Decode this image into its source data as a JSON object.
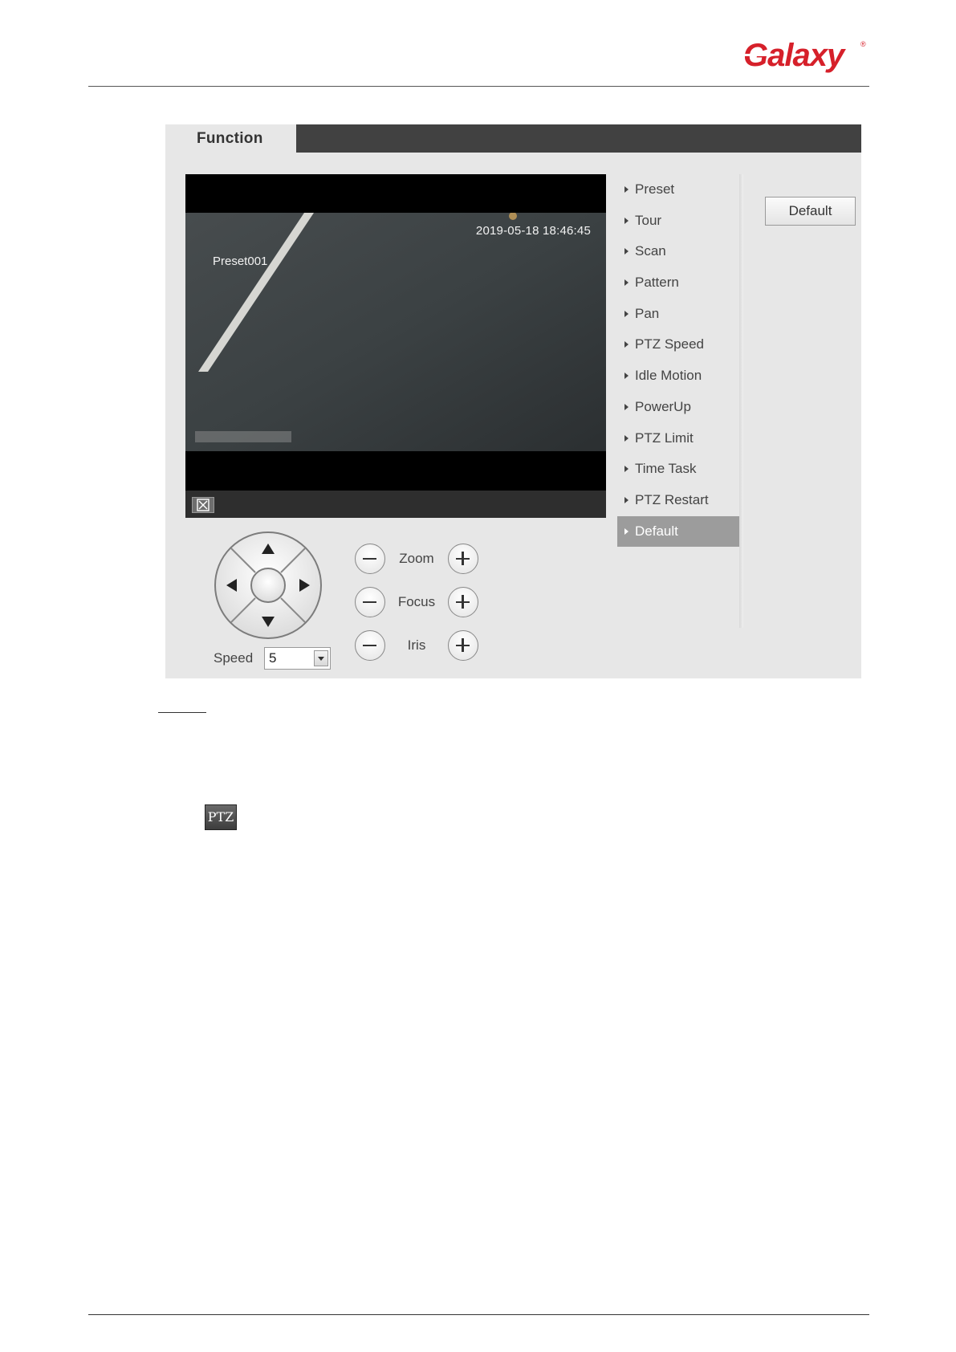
{
  "brand": {
    "logo_text": "Galaxy",
    "registered": "®"
  },
  "panel": {
    "tab_label": "Function",
    "video": {
      "timestamp": "2019-05-18 18:46:45",
      "preset_label": "Preset001"
    },
    "menu": [
      {
        "label": "Preset"
      },
      {
        "label": "Tour"
      },
      {
        "label": "Scan"
      },
      {
        "label": "Pattern"
      },
      {
        "label": "Pan"
      },
      {
        "label": "PTZ Speed"
      },
      {
        "label": "Idle Motion"
      },
      {
        "label": "PowerUp"
      },
      {
        "label": "PTZ Limit"
      },
      {
        "label": "Time Task"
      },
      {
        "label": "PTZ Restart"
      },
      {
        "label": "Default",
        "active": true
      }
    ],
    "default_button": "Default",
    "controls": {
      "zoom": "Zoom",
      "focus": "Focus",
      "iris": "Iris"
    },
    "speed": {
      "label": "Speed",
      "value": "5"
    }
  },
  "icons": {
    "ptz_icon_label": "PTZ"
  },
  "colors": {
    "brand_red": "#d6202a",
    "active_menu": "#9c9c9c",
    "tab_bar": "#414141"
  }
}
